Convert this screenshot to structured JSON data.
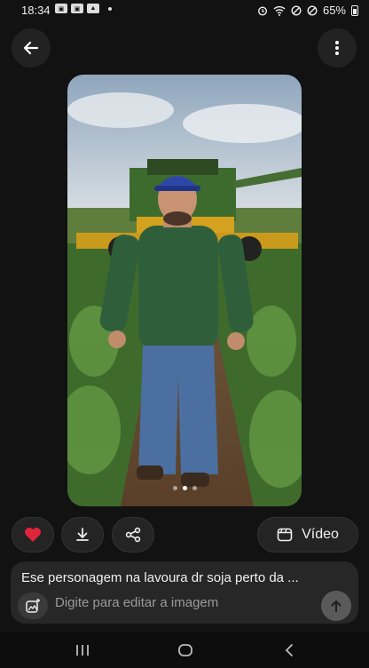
{
  "status_bar": {
    "time": "18:34",
    "battery_percent": "65%",
    "left_icons": [
      "app-icon",
      "app-icon",
      "image-icon"
    ],
    "right_icons": [
      "alarm-icon",
      "wifi-icon",
      "dnd-icon",
      "dnd-icon",
      "battery-icon"
    ]
  },
  "header": {
    "back_icon": "arrow-left-icon",
    "menu_icon": "vertical-dots-icon"
  },
  "carousel": {
    "page_count": 3,
    "active_index": 1
  },
  "actions": {
    "like_icon": "heart-icon",
    "download_icon": "download-icon",
    "share_icon": "share-icon",
    "video_label": "Vídeo",
    "video_icon": "film-icon"
  },
  "composer": {
    "prompt_text": "Ese personagem  na lavoura dr soja perto da ...",
    "placeholder": "Digite para editar a imagem",
    "edit_icon": "image-sparkle-icon",
    "send_icon": "arrow-up-icon"
  },
  "colors": {
    "background": "#121212",
    "heart": "#e0243a",
    "panel": "#272727"
  }
}
